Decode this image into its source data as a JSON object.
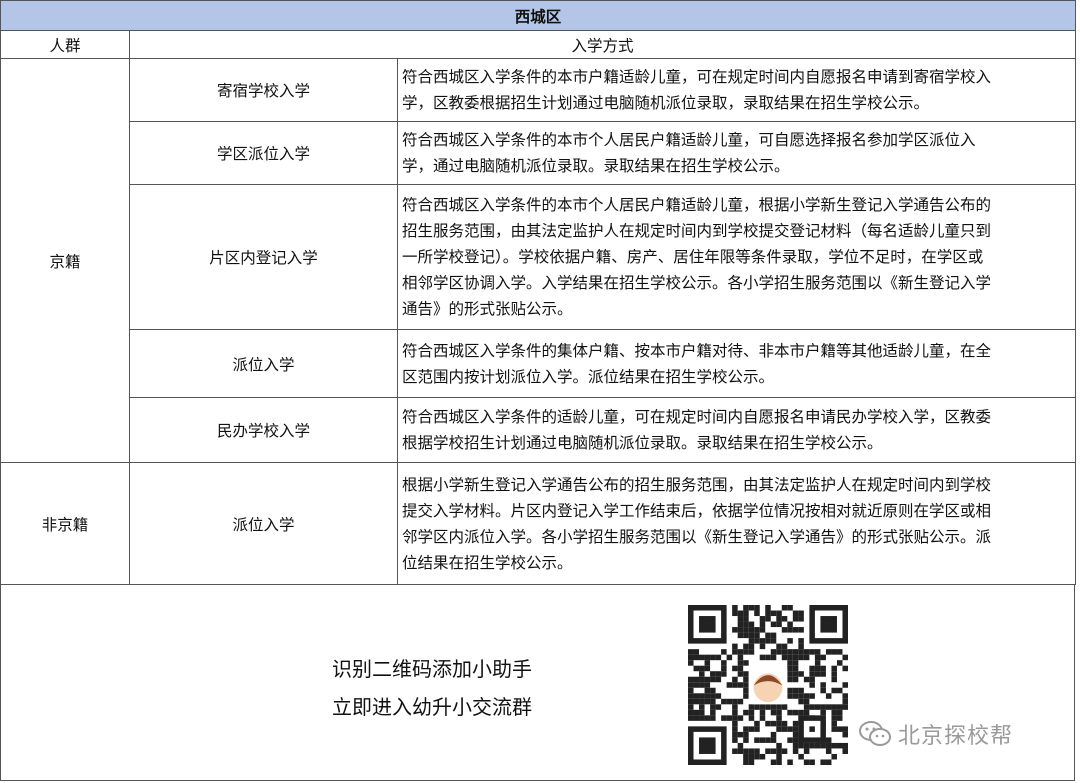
{
  "table": {
    "title": "西城区",
    "headers": {
      "group": "人群",
      "method": "入学方式"
    },
    "groups": [
      {
        "name": "京籍",
        "rows": [
          {
            "method": "寄宿学校入学",
            "lines": [
              "符合西城区入学条件的本市户籍适龄儿童，可在规定时间内自愿报名申请到寄宿学校入",
              "学，区教委根据招生计划通过电脑随机派位录取，录取结果在招生学校公示。"
            ]
          },
          {
            "method": "学区派位入学",
            "lines": [
              "符合西城区入学条件的本市个人居民户籍适龄儿童，可自愿选择报名参加学区派位入",
              "学，通过电脑随机派位录取。录取结果在招生学校公示。"
            ]
          },
          {
            "method": "片区内登记入学",
            "lines": [
              "符合西城区入学条件的本市个人居民户籍适龄儿童，根据小学新生登记入学通告公布的",
              "招生服务范围，由其法定监护人在规定时间内到学校提交登记材料（每名适龄儿童只到",
              "一所学校登记）。学校依据户籍、房产、居住年限等条件录取，学位不足时，在学区或",
              "相邻学区协调入学。入学结果在招生学校公示。各小学招生服务范围以《新生登记入学",
              "通告》的形式张贴公示。"
            ]
          },
          {
            "method": "派位入学",
            "lines": [
              "符合西城区入学条件的集体户籍、按本市户籍对待、非本市户籍等其他适龄儿童，在全",
              "区范围内按计划派位入学。派位结果在招生学校公示。"
            ]
          },
          {
            "method": "民办学校入学",
            "lines": [
              "符合西城区入学条件的适龄儿童，可在规定时间内自愿报名申请民办学校入学，区教委",
              "根据学校招生计划通过电脑随机派位录取。录取结果在招生学校公示。"
            ]
          }
        ]
      },
      {
        "name": "非京籍",
        "rows": [
          {
            "method": "派位入学",
            "lines": [
              "根据小学新生登记入学通告公布的招生服务范围，由其法定监护人在规定时间内到学校",
              "提交入学材料。片区内登记入学工作结束后，依据学位情况按相对就近原则在学区或相",
              "邻学区内派位入学。各小学招生服务范围以《新生登记入学通告》的形式张贴公示。派",
              "位结果在招生学校公示。"
            ]
          }
        ]
      }
    ]
  },
  "footer": {
    "caption_line1": "识别二维码添加小助手",
    "caption_line2": "立即进入幼升小交流群",
    "watermark": "北京探校帮"
  },
  "colors": {
    "title_bg": "#b4c6e7",
    "border": "#555555",
    "watermark": "#9a9a9a"
  }
}
